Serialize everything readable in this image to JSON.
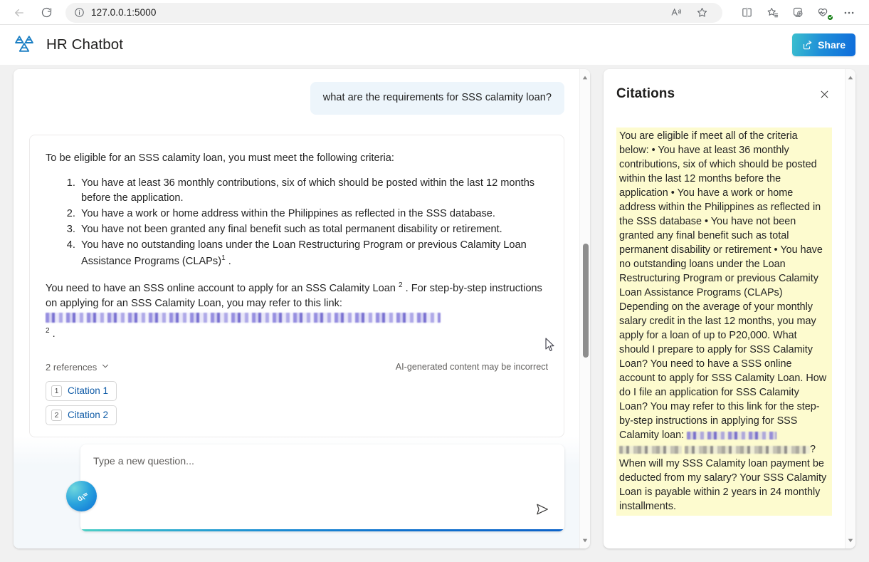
{
  "browser": {
    "url": "127.0.0.1:5000",
    "back_tooltip": "Back",
    "refresh_tooltip": "Refresh",
    "info_tooltip": "View site information",
    "read_aloud_tooltip": "Read aloud",
    "favorite_tooltip": "Add this page to favorites",
    "split_screen_tooltip": "Split screen",
    "collections_tooltip": "Collections",
    "add_tab_tooltip": "Browser essentials",
    "settings_tooltip": "Settings and more"
  },
  "header": {
    "title": "HR Chatbot",
    "share_label": "Share"
  },
  "chat": {
    "user_message": "what are the requirements for SSS calamity loan?",
    "answer": {
      "intro": "To be eligible for an SSS calamity loan, you must meet the following criteria:",
      "items": [
        "You have at least 36 monthly contributions, six of which should be posted within the last 12 months before the application.",
        "You have a work or home address within the Philippines as reflected in the SSS database.",
        "You have not been granted any final benefit such as total permanent disability or retirement.",
        "You have no outstanding loans under the Loan Restructuring Program or previous Calamity Loan Assistance Programs (CLAPs)"
      ],
      "item4_citation": "1",
      "item4_tail": ".",
      "para_part1": "You need to have an SSS online account to apply for an SSS Calamity Loan",
      "para_cite1": "2",
      "para_part2": ". For step-by-step instructions on applying for an SSS Calamity Loan, you may refer to this link:",
      "para_cite2": "2",
      "para_tail": ".",
      "link_redacted": "[redacted link]"
    },
    "references_label": "2 references",
    "disclaimer": "AI-generated content may be incorrect",
    "citations": [
      {
        "number": "1",
        "label": "Citation 1"
      },
      {
        "number": "2",
        "label": "Citation 2"
      }
    ]
  },
  "composer": {
    "placeholder": "Type a new question...",
    "value": "",
    "send_label": "Send",
    "clear_label": "Clear chat"
  },
  "citations_panel": {
    "title": "Citations",
    "close_label": "Close",
    "text_part1": "You are eligible if meet all of the criteria below: • You have at least 36 monthly contributions, six of which should be posted within the last 12 months before the application • You have a work or home address within the Philippines as reflected in the SSS database • You have not been granted any final benefit such as total permanent disability or retirement • You have no outstanding loans under the Loan Restructuring Program or previous Calamity Loan Assistance Programs (CLAPs) Depending on the average of your monthly salary credit in the last 12 months, you may apply for a loan of up to P20,000. What should I prepare to apply for SSS Calamity Loan? You need to have a SSS online account to apply for SSS Calamity Loan. How do I file an application for SSS Calamity Loan? You may refer to this link for the step-by-step instructions in applying for SSS Calamity loan:",
    "redacted_1": "[redacted]",
    "redacted_2": "[redacted]",
    "redacted_3": "[redacted]",
    "text_part2": "? When will my SSS Calamity loan payment be deducted from my salary? Your SSS Calamity Loan is payable within 2 years in 24 monthly installments."
  },
  "annotation": {
    "arrow_color": "#a81818",
    "points_to": "Citation 1"
  },
  "colors": {
    "accent_blue": "#0f6cdb",
    "accent_teal": "#3bbfce",
    "citation_link": "#0f5ba7",
    "highlight_yellow": "#fdfbcf",
    "user_bubble": "#edf5fb"
  }
}
